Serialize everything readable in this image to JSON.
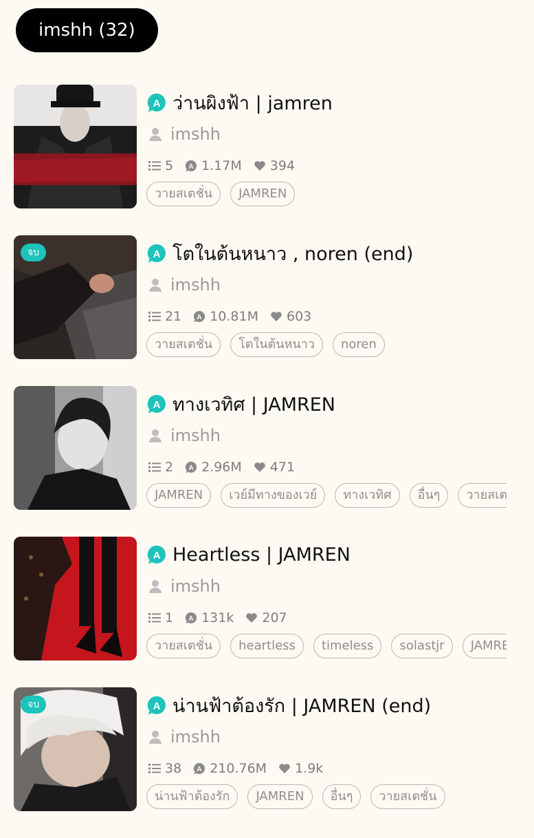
{
  "author_pill": "imshh (32)",
  "colors": {
    "accent": "#1ec3bb",
    "pill_bg": "#000000",
    "page_bg": "#fdf9f3"
  },
  "icons": {
    "reads": "a-bubble-icon",
    "chapters": "list-icon",
    "likes": "heart-icon",
    "writer": "person-icon"
  },
  "stories": [
    {
      "title": "ว่านผิงฟ้า | jamren",
      "writer": "imshh",
      "chapters": "5",
      "reads": "1.17M",
      "likes": "394",
      "tags": [
        "วายสเตชั่น",
        "JAMREN"
      ],
      "end_badge": ""
    },
    {
      "title": "โตในต้นหนาว , noren (end)",
      "writer": "imshh",
      "chapters": "21",
      "reads": "10.81M",
      "likes": "603",
      "tags": [
        "วายสเตชั่น",
        "โตในต้นหนาว",
        "noren"
      ],
      "end_badge": "จบ"
    },
    {
      "title": "ทางเวทิศ | JAMREN",
      "writer": "imshh",
      "chapters": "2",
      "reads": "2.96M",
      "likes": "471",
      "tags": [
        "JAMREN",
        "เวย์มีทางของเวย์",
        "ทางเวทิศ",
        "อื่นๆ",
        "วายสเตชั่น"
      ],
      "end_badge": ""
    },
    {
      "title": "Heartless | JAMREN",
      "writer": "imshh",
      "chapters": "1",
      "reads": "131k",
      "likes": "207",
      "tags": [
        "วายสเตชั่น",
        "heartless",
        "timeless",
        "solastjr",
        "JAMREN"
      ],
      "end_badge": ""
    },
    {
      "title": "น่านฟ้าต้องรัก | JAMREN (end)",
      "writer": "imshh",
      "chapters": "38",
      "reads": "210.76M",
      "likes": "1.9k",
      "tags": [
        "น่านฟ้าต้องรัก",
        "JAMREN",
        "อื่นๆ",
        "วายสเตชั่น"
      ],
      "end_badge": "จบ"
    }
  ]
}
